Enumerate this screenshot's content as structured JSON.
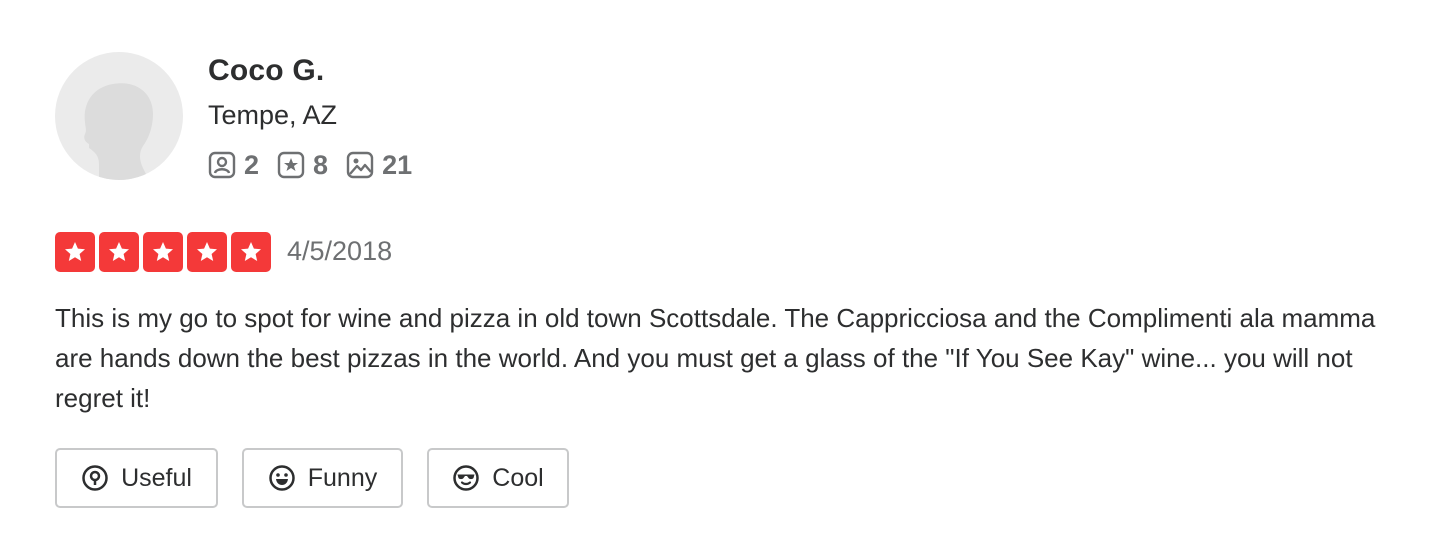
{
  "user": {
    "name": "Coco G.",
    "location": "Tempe, AZ",
    "avatar_icon": "default-user-silhouette",
    "stats": {
      "friends": {
        "icon": "friends-icon",
        "value": "2"
      },
      "reviews": {
        "icon": "review-star-icon",
        "value": "8"
      },
      "photos": {
        "icon": "photo-icon",
        "value": "21"
      }
    }
  },
  "review": {
    "rating": 5,
    "rating_color": "#f43939",
    "date": "4/5/2018",
    "text": "This is my go to spot for wine and pizza in old town Scottsdale. The Cappricciosa and the Complimenti ala mamma are hands down the best pizzas in the world. And you must get a glass of the \"If You See Kay\" wine... you will not regret it!"
  },
  "actions": {
    "useful_label": "Useful",
    "funny_label": "Funny",
    "cool_label": "Cool"
  }
}
